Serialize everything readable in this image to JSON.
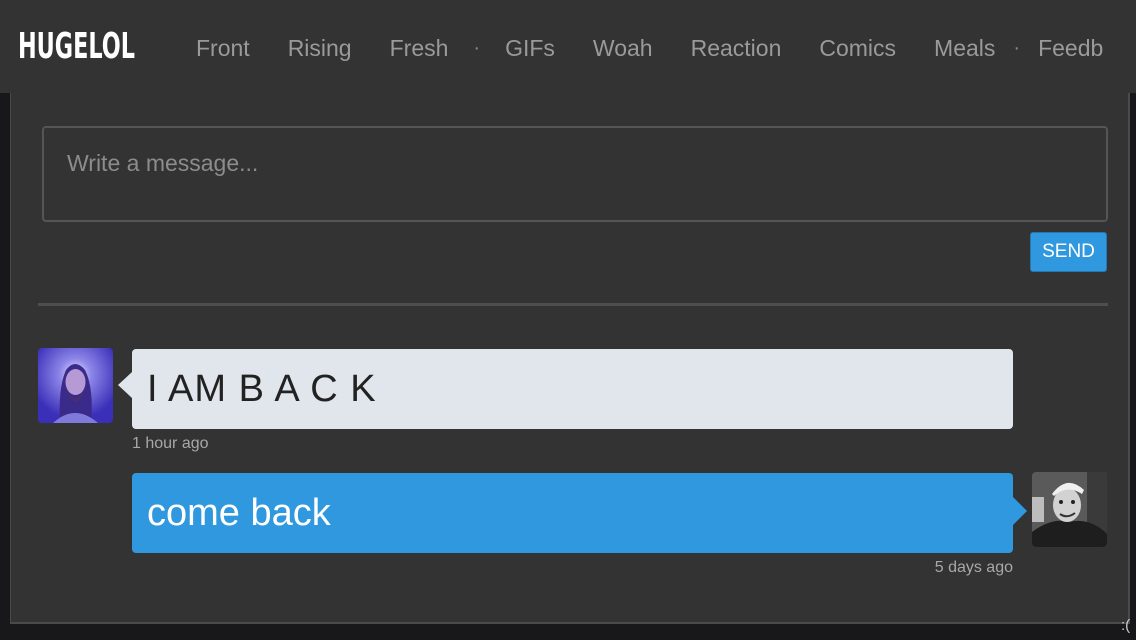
{
  "header": {
    "logo": "HUGELOL",
    "nav": [
      {
        "label": "Front"
      },
      {
        "label": "Rising"
      },
      {
        "label": "Fresh"
      },
      {
        "label": "GIFs"
      },
      {
        "label": "Woah"
      },
      {
        "label": "Reaction"
      },
      {
        "label": "Comics"
      },
      {
        "label": "Meals"
      },
      {
        "label": "Feedb"
      }
    ],
    "separator": "·"
  },
  "composer": {
    "placeholder": "Write a message...",
    "value": "",
    "send_label": "SEND"
  },
  "messages": [
    {
      "direction": "incoming",
      "text": "I AM B A C K",
      "time": "1 hour ago",
      "avatar_icon": "user-avatar-robed-figure"
    },
    {
      "direction": "outgoing",
      "text": "come back",
      "time": "5 days ago",
      "avatar_icon": "user-avatar-sailor"
    }
  ],
  "colors": {
    "accent": "#2f98de",
    "incoming_bubble": "#e0e6ec",
    "background": "#333333"
  },
  "corner_text": ":("
}
